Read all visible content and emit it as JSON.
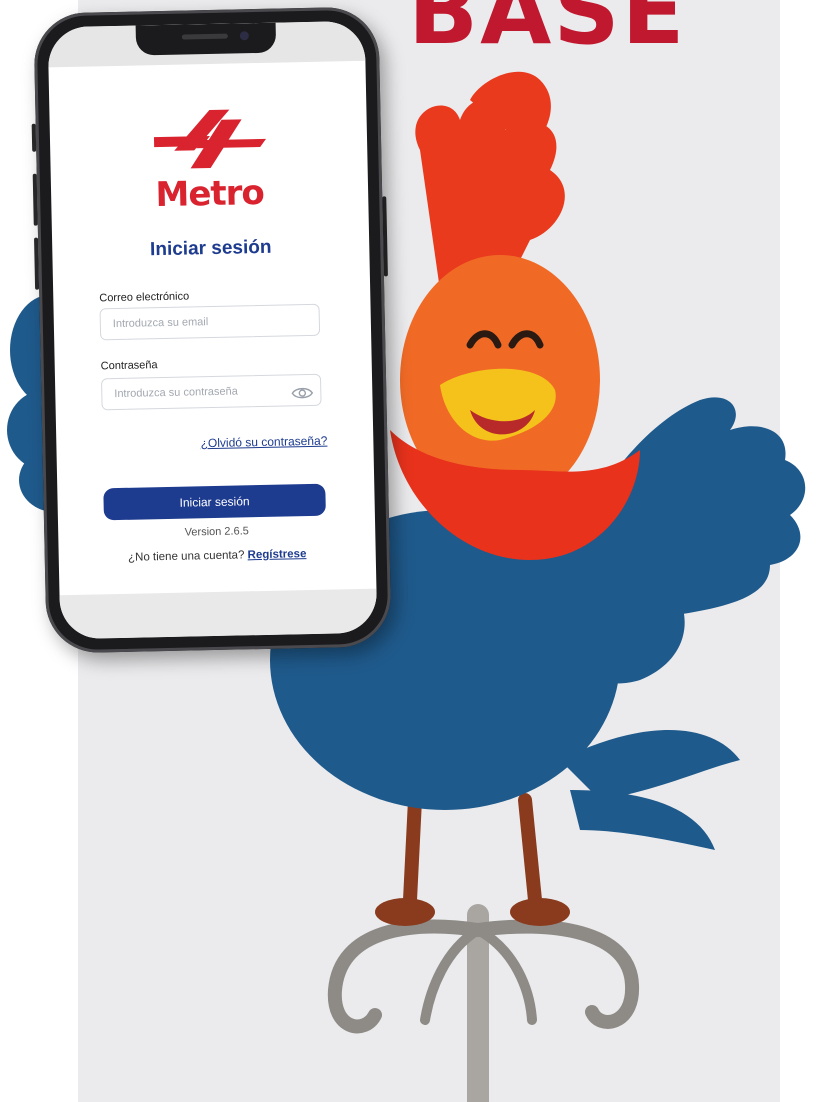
{
  "promo": {
    "headline": "BASE"
  },
  "login_screen": {
    "brand_name": "Metro",
    "title": "Iniciar sesión",
    "email": {
      "label": "Correo electrónico",
      "placeholder": "Introduzca su email",
      "value": ""
    },
    "password": {
      "label": "Contraseña",
      "placeholder": "Introduzca su contraseña",
      "value": ""
    },
    "forgot_password_link": "¿Olvidó su contraseña?",
    "submit_button": "Iniciar sesión",
    "version": "Version 2.6.5",
    "register_prompt": "¿No tiene una cuenta?",
    "register_link": "Regístrese"
  },
  "colors": {
    "brand_red": "#d9232f",
    "brand_blue": "#1d3b8f",
    "headline_red": "#c0182e",
    "rooster_blue": "#1f5a8c",
    "rooster_orange": "#f06a26",
    "rooster_red": "#e8321c",
    "beak_yellow": "#f5c21b"
  },
  "icons": [
    "metro-logo-icon",
    "show-password-eye-icon"
  ]
}
